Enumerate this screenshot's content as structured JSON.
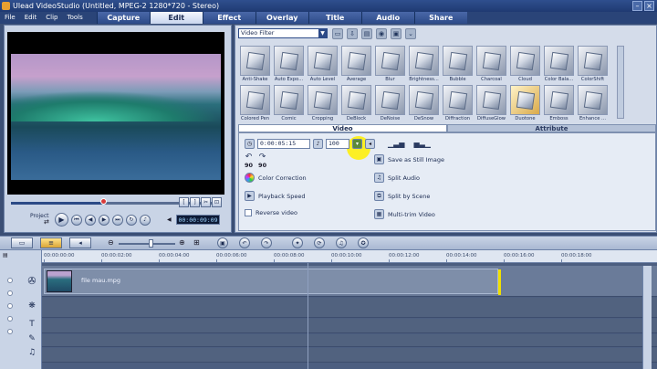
{
  "window": {
    "title": "Ulead VideoStudio (Untitled, MPEG-2 1280*720 - Stereo)"
  },
  "menu": [
    "File",
    "Edit",
    "Clip",
    "Tools"
  ],
  "steps": [
    {
      "label": "Capture",
      "active": false
    },
    {
      "label": "Edit",
      "active": true
    },
    {
      "label": "Effect",
      "active": false
    },
    {
      "label": "Overlay",
      "active": false
    },
    {
      "label": "Title",
      "active": false
    },
    {
      "label": "Audio",
      "active": false
    },
    {
      "label": "Share",
      "active": false
    }
  ],
  "preview": {
    "mode_label": "Project",
    "timecode": "00:00:09:09"
  },
  "library": {
    "category": "Video Filter",
    "filters_row1": [
      "Anti-Shake",
      "Auto Expo...",
      "Auto Level",
      "Average",
      "Blur",
      "Brightness...",
      "Bubble",
      "Charcoal",
      "Cloud",
      "Color Bala...",
      "ColorShift"
    ],
    "filters_row2": [
      "Colored Pen",
      "Comic",
      "Cropping",
      "DeBlock",
      "DeNoise",
      "DeSnow",
      "Diffraction",
      "DiffuseGlow",
      "Duotone",
      "Emboss",
      "Enhance ..."
    ]
  },
  "options": {
    "tabs": [
      {
        "label": "Video",
        "active": true
      },
      {
        "label": "Attribute",
        "active": false
      }
    ],
    "duration": "0:00:05:15",
    "volume": "100",
    "rotate_left": "90",
    "rotate_right": "90",
    "color_correction": "Color Correction",
    "playback_speed": "Playback Speed",
    "reverse_video": "Reverse video",
    "save_still": "Save as Still Image",
    "split_audio": "Split Audio",
    "split_scene": "Split by Scene",
    "multi_trim": "Multi-trim Video"
  },
  "timeline": {
    "ruler": [
      "00:00:00:00",
      "00:00:02:00",
      "00:00:04:00",
      "00:00:06:00",
      "00:00:08:00",
      "00:00:10:00",
      "00:00:12:00",
      "00:00:14:00",
      "00:00:16:00",
      "00:00:18:00"
    ],
    "clip_name": "file mau.mpg"
  },
  "colors": {
    "accent": "#2c4a88",
    "highlight": "#fff000",
    "clip_end": "#f0e000"
  }
}
